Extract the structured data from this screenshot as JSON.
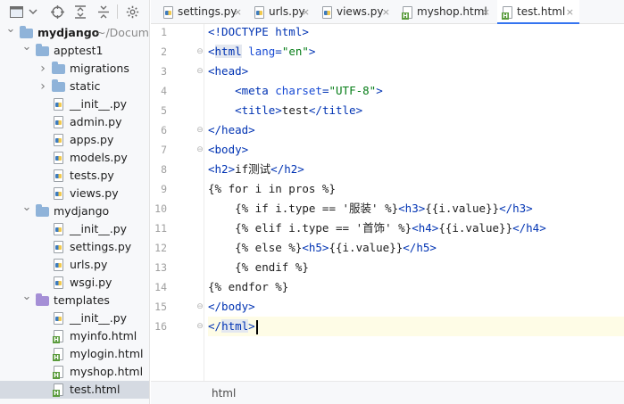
{
  "project_toolbar": {
    "icons": [
      "project-view-icon",
      "chevron-down-icon",
      "locate-icon",
      "expand-all-icon",
      "collapse-all-icon",
      "gear-icon"
    ]
  },
  "tree": [
    {
      "label": "mydjango",
      "suffix": "~/Documer",
      "kind": "folder",
      "depth": 0,
      "expanded": true,
      "bold": true
    },
    {
      "label": "apptest1",
      "kind": "folder",
      "depth": 1,
      "expanded": true
    },
    {
      "label": "migrations",
      "kind": "folder",
      "depth": 2,
      "expanded": false
    },
    {
      "label": "static",
      "kind": "folder",
      "depth": 2,
      "expanded": false
    },
    {
      "label": "__init__.py",
      "kind": "py",
      "depth": 2
    },
    {
      "label": "admin.py",
      "kind": "py",
      "depth": 2
    },
    {
      "label": "apps.py",
      "kind": "py",
      "depth": 2
    },
    {
      "label": "models.py",
      "kind": "py",
      "depth": 2
    },
    {
      "label": "tests.py",
      "kind": "py",
      "depth": 2
    },
    {
      "label": "views.py",
      "kind": "py",
      "depth": 2
    },
    {
      "label": "mydjango",
      "kind": "folder",
      "depth": 1,
      "expanded": true
    },
    {
      "label": "__init__.py",
      "kind": "py",
      "depth": 2
    },
    {
      "label": "settings.py",
      "kind": "py",
      "depth": 2
    },
    {
      "label": "urls.py",
      "kind": "py",
      "depth": 2
    },
    {
      "label": "wsgi.py",
      "kind": "py",
      "depth": 2
    },
    {
      "label": "templates",
      "kind": "folder-purple",
      "depth": 1,
      "expanded": true
    },
    {
      "label": "__init__.py",
      "kind": "py",
      "depth": 2
    },
    {
      "label": "myinfo.html",
      "kind": "html",
      "depth": 2
    },
    {
      "label": "mylogin.html",
      "kind": "html",
      "depth": 2
    },
    {
      "label": "myshop.html",
      "kind": "html",
      "depth": 2
    },
    {
      "label": "test.html",
      "kind": "html",
      "depth": 2,
      "selected": true
    }
  ],
  "tabs": [
    {
      "label": "settings.py",
      "kind": "py",
      "close": "×"
    },
    {
      "label": "urls.py",
      "kind": "py",
      "close": "×"
    },
    {
      "label": "views.py",
      "kind": "py",
      "close": "×"
    },
    {
      "label": "myshop.html",
      "kind": "html",
      "close": "×"
    },
    {
      "label": "test.html",
      "kind": "html",
      "close": "×",
      "active": true
    }
  ],
  "editor": {
    "current_line": 16,
    "lines": [
      [
        [
          "tag",
          "<!DOCTYPE html>"
        ]
      ],
      [
        [
          "tag",
          "<"
        ],
        [
          "tag hl",
          "html"
        ],
        [
          "attr",
          " lang"
        ],
        [
          "tag",
          "="
        ],
        [
          "str",
          "\"en\""
        ],
        [
          "tag",
          ">"
        ]
      ],
      [
        [
          "tag",
          "<head>"
        ]
      ],
      [
        [
          "tpl",
          "    "
        ],
        [
          "tag",
          "<meta"
        ],
        [
          "attr",
          " charset"
        ],
        [
          "tag",
          "="
        ],
        [
          "str",
          "\"UTF-8\""
        ],
        [
          "tag",
          ">"
        ]
      ],
      [
        [
          "tpl",
          "    "
        ],
        [
          "tag",
          "<title>"
        ],
        [
          "tpl",
          "test"
        ],
        [
          "tag",
          "</title>"
        ]
      ],
      [
        [
          "tag",
          "</head>"
        ]
      ],
      [
        [
          "tag",
          "<body>"
        ]
      ],
      [
        [
          "tag",
          "<h2>"
        ],
        [
          "tpl",
          "if测试"
        ],
        [
          "tag",
          "</h2>"
        ]
      ],
      [
        [
          "tpl",
          "{% for i in pros %}"
        ]
      ],
      [
        [
          "tpl",
          "    {% if i.type == '服装' %}"
        ],
        [
          "tag",
          "<h3>"
        ],
        [
          "tpl",
          "{{i.value}}"
        ],
        [
          "tag",
          "</h3>"
        ]
      ],
      [
        [
          "tpl",
          "    {% elif i.type == '首饰' %}"
        ],
        [
          "tag",
          "<h4>"
        ],
        [
          "tpl",
          "{{i.value}}"
        ],
        [
          "tag",
          "</h4>"
        ]
      ],
      [
        [
          "tpl",
          "    {% else %}"
        ],
        [
          "tag",
          "<h5>"
        ],
        [
          "tpl",
          "{{i.value}}"
        ],
        [
          "tag",
          "</h5>"
        ]
      ],
      [
        [
          "tpl",
          "    {% endif %}"
        ]
      ],
      [
        [
          "tpl",
          "{% endfor %}"
        ]
      ],
      [
        [
          "tag",
          "</body>"
        ]
      ],
      [
        [
          "tag",
          "</"
        ],
        [
          "tag hl",
          "html"
        ],
        [
          "tag",
          ">"
        ]
      ]
    ],
    "fold_markers": {
      "2": "⊖",
      "3": "⊖",
      "6": "⊖",
      "7": "⊖",
      "15": "⊖",
      "16": "⊖"
    }
  },
  "statusbar": {
    "breadcrumb": "html"
  },
  "colors": {
    "accent": "#3574f0",
    "tag": "#0033b3",
    "string": "#067d17",
    "selection": "#d5dae2",
    "folder_blue": "#8fb3d9",
    "folder_purple": "#a58fd6"
  }
}
